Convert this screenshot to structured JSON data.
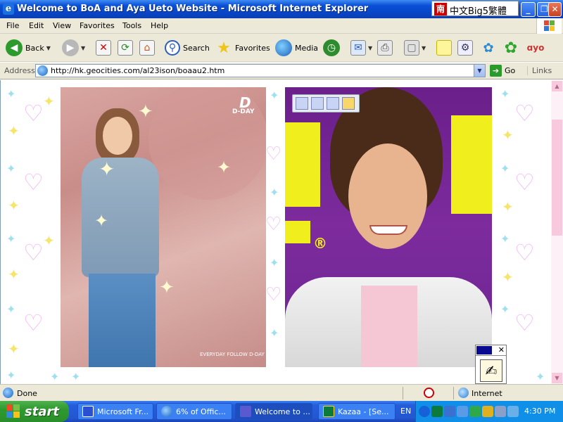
{
  "window": {
    "title": "Welcome to BoA and Aya Ueto Website - Microsoft Internet Explorer",
    "ime_indicator": "中文Big5繁體",
    "ime_logo": "南",
    "controls": {
      "minimize": "_",
      "restore": "❐",
      "close": "✕"
    }
  },
  "menu": {
    "items": [
      "File",
      "Edit",
      "View",
      "Favorites",
      "Tools",
      "Help"
    ]
  },
  "toolbar": {
    "back_label": "Back",
    "search_label": "Search",
    "favorites_label": "Favorites",
    "media_label": "Media",
    "icons": [
      "back-icon",
      "forward-icon",
      "stop-icon",
      "refresh-icon",
      "home-icon",
      "search-icon",
      "favorites-icon",
      "media-icon",
      "history-icon",
      "mail-icon",
      "print-icon",
      "edit-icon",
      "discuss-icon",
      "messenger-icon",
      "icq-icon",
      "msn-butterfly-icon"
    ]
  },
  "address": {
    "label": "Address",
    "url": "http://hk.geocities.com/al23ison/boaau2.htm",
    "go_label": "Go",
    "links_label": "Links"
  },
  "content": {
    "boa_brand": "D-DAY",
    "boa_caption": "EVERYDAY FOLLOW D-DAY",
    "aya_mark": "®"
  },
  "status": {
    "text": "Done",
    "zone": "Internet"
  },
  "taskbar": {
    "start_label": "start",
    "tasks": [
      "Microsoft Fr...",
      "6% of Offic...",
      "Welcome to ...",
      "Kazaa - [Se..."
    ],
    "language": "EN",
    "clock": "4:30 PM"
  },
  "colors": {
    "titlebar": "#0a4fd6",
    "taskbar": "#245ddb",
    "start": "#2e9a2e",
    "tray": "#0f8fe8",
    "deco_heart": "#f2b8f4",
    "scrollbar": "#f8c9dd"
  }
}
